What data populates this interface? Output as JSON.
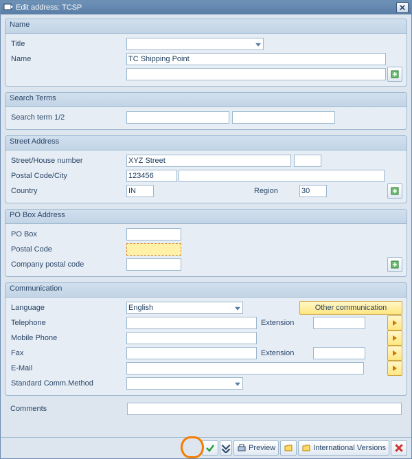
{
  "window": {
    "title": "Edit address:   TCSP"
  },
  "name_group": {
    "header": "Name",
    "title_label": "Title",
    "title_value": "",
    "name_label": "Name",
    "name_value": "TC Shipping Point",
    "name2_value": ""
  },
  "search_group": {
    "header": "Search Terms",
    "term_label": "Search term 1/2",
    "term1": "",
    "term2": ""
  },
  "street_group": {
    "header": "Street Address",
    "street_label": "Street/House number",
    "street_value": "XYZ Street",
    "house_value": "",
    "postal_label": "Postal Code/City",
    "postal_value": "123456",
    "city_value": "",
    "country_label": "Country",
    "country_value": "IN",
    "region_label": "Region",
    "region_value": "30"
  },
  "pobox_group": {
    "header": "PO Box Address",
    "pobox_label": "PO Box",
    "pobox_value": "",
    "postal_label": "Postal Code",
    "postal_value": "",
    "company_label": "Company postal code",
    "company_value": ""
  },
  "comm_group": {
    "header": "Communication",
    "lang_label": "Language",
    "lang_value": "English",
    "other_comm_label": "Other communication",
    "tel_label": "Telephone",
    "tel_value": "",
    "ext_label": "Extension",
    "tel_ext": "",
    "mobile_label": "Mobile Phone",
    "mobile_value": "",
    "fax_label": "Fax",
    "fax_value": "",
    "fax_ext": "",
    "email_label": "E-Mail",
    "email_value": "",
    "std_label": "Standard Comm.Method",
    "std_value": ""
  },
  "comments_label": "Comments",
  "comments_value": "",
  "footer": {
    "preview": "Preview",
    "intl": "International Versions"
  }
}
